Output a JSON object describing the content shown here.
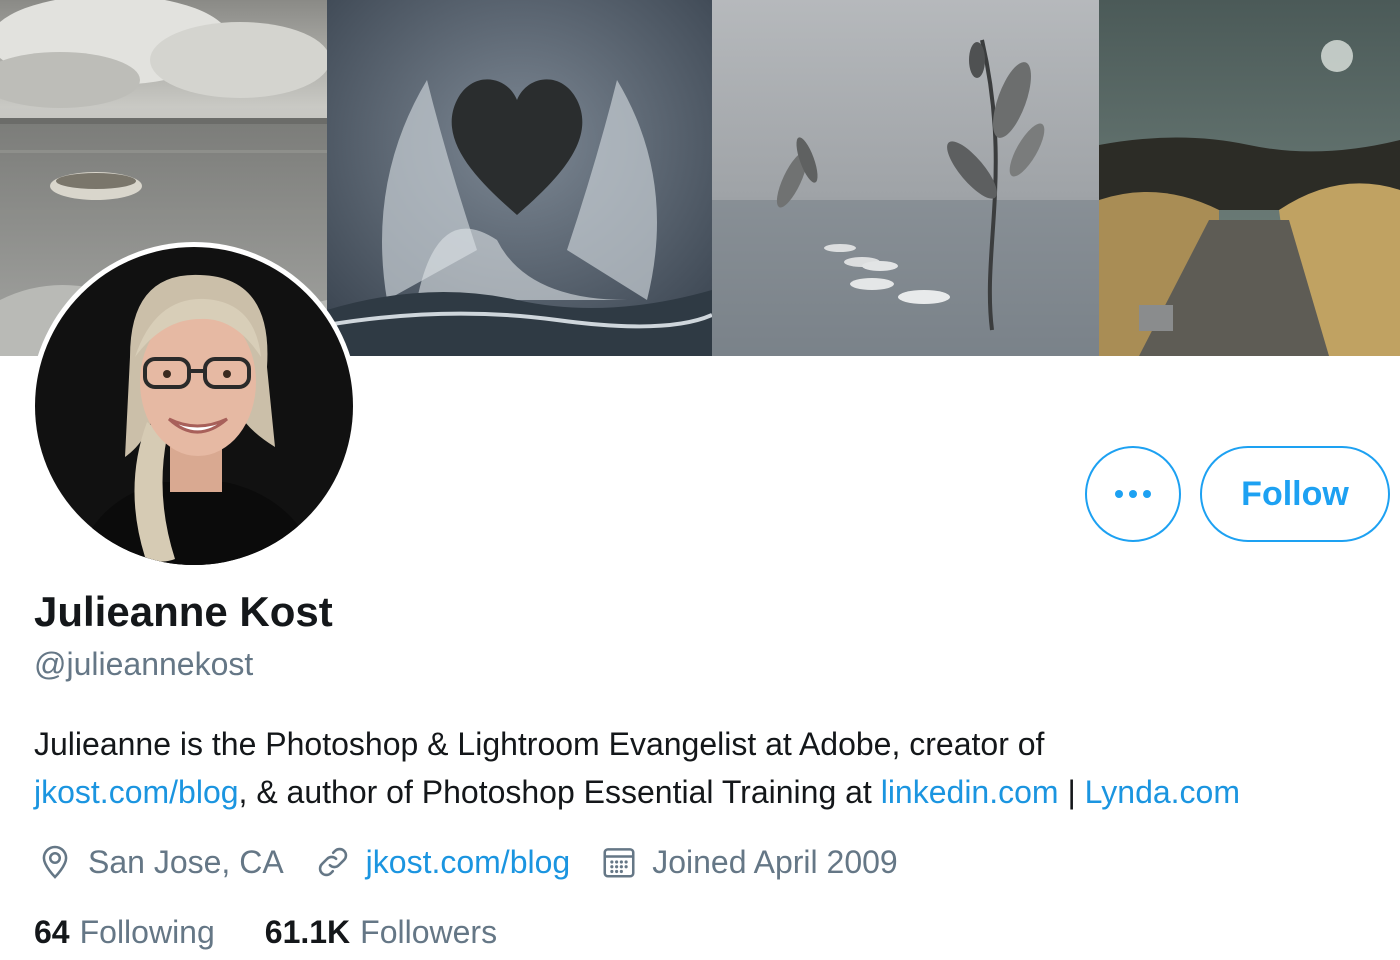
{
  "profile": {
    "name": "Julieanne Kost",
    "handle": "@julieannekost",
    "bio": {
      "part1": "Julieanne is the Photoshop & Lightroom Evangelist at Adobe, creator of",
      "link1": "jkost.com/blog",
      "part2": ", & author of Photoshop Essential Training at ",
      "link2": "linkedin.com",
      "part3": " | ",
      "link3": "Lynda.com"
    },
    "location": "San Jose, CA",
    "website": "jkost.com/blog",
    "joined": "Joined April 2009",
    "following_count": "64",
    "following_label": "Following",
    "followers_count": "61.1K",
    "followers_label": "Followers"
  },
  "actions": {
    "follow_label": "Follow"
  },
  "icons": {
    "more": "more-dots-icon",
    "location": "location-pin-icon",
    "link": "link-icon",
    "calendar": "calendar-icon"
  },
  "colors": {
    "accent": "#1da1f2",
    "link": "#1b95e0",
    "secondary_text": "#657786",
    "primary_text": "#14171a"
  }
}
